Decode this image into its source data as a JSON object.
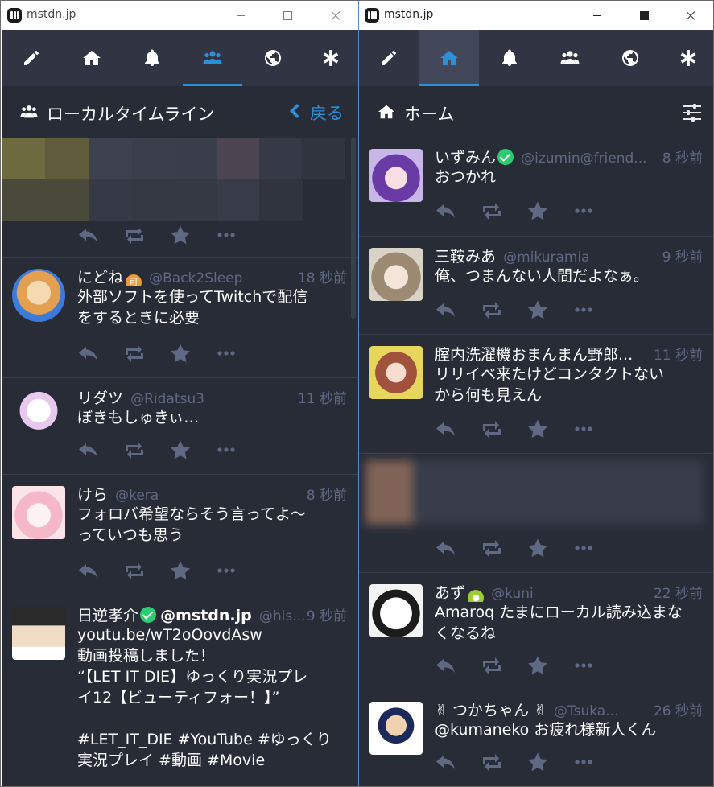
{
  "colors": {
    "accent": "#2b90d9",
    "bg": "#282c37",
    "nav_bg": "#313543",
    "muted": "#606984",
    "verified": "#2ecc71"
  },
  "window_left": {
    "title": "mstdn.jp",
    "nav_tabs": [
      "compose-icon",
      "home-icon",
      "notifications-icon",
      "local-timeline-icon",
      "federated-timeline-icon",
      "settings-icon"
    ],
    "active_tab": "local-timeline",
    "column_title": "ローカルタイムライン",
    "back_label": "戻る",
    "statuses": [
      {
        "display_name": "にどね",
        "acct": "@Back2Sleep",
        "time": "18 秒前",
        "content": "外部ソフトを使ってTwitchで配信\nをするときに必要"
      },
      {
        "display_name": "リダツ",
        "acct": "@Ridatsu3",
        "time": "11 秒前",
        "content": "ぼきもしゅきぃ…"
      },
      {
        "display_name": "けら",
        "acct": "@kera",
        "time": "8 秒前",
        "content": "フォロバ希望ならそう言ってよ～\nっていつも思う"
      },
      {
        "display_name": "日逆孝介",
        "display_suffix": "@mstdn.jp",
        "acct": "@his...",
        "time": "9 秒前",
        "content": "youtu.be/wT2oOovdAsw\n動画投稿しました！\n“【LET IT DIE】ゆっくり実況プレ\nイ12【ビューティフォー！】”\n\n#LET_IT_DIE #YouTube #ゆっくり\n実況プレイ #動画 #Movie"
      }
    ]
  },
  "window_right": {
    "title": "mstdn.jp",
    "nav_tabs": [
      "compose-icon",
      "home-icon",
      "notifications-icon",
      "local-timeline-icon",
      "federated-timeline-icon",
      "settings-icon"
    ],
    "active_tab": "home",
    "column_title": "ホーム",
    "statuses": [
      {
        "display_name": "いずみん",
        "acct": "@izumin@friend...",
        "time": "8 秒前",
        "content": "おつかれ"
      },
      {
        "display_name": "三鞍みあ",
        "acct": "@mikuramia",
        "time": "9 秒前",
        "content": "俺、つまんない人間だよなぁ。"
      },
      {
        "display_name": "腟内洗濯機おまんまん野郎...",
        "acct": "",
        "time": "11 秒前",
        "content": "リリイベ来たけどコンタクトない\nから何も見えん"
      },
      {
        "display_name": "あず",
        "acct": "@kuni",
        "time": "22 秒前",
        "content": "Amaroq たまにローカル読み込まな\nくなるね"
      },
      {
        "display_name": "✌ つかちゃん ✌",
        "acct": "@Tsuka...",
        "time": "26 秒前",
        "content": "@kumaneko お疲れ様新人くん"
      }
    ]
  }
}
